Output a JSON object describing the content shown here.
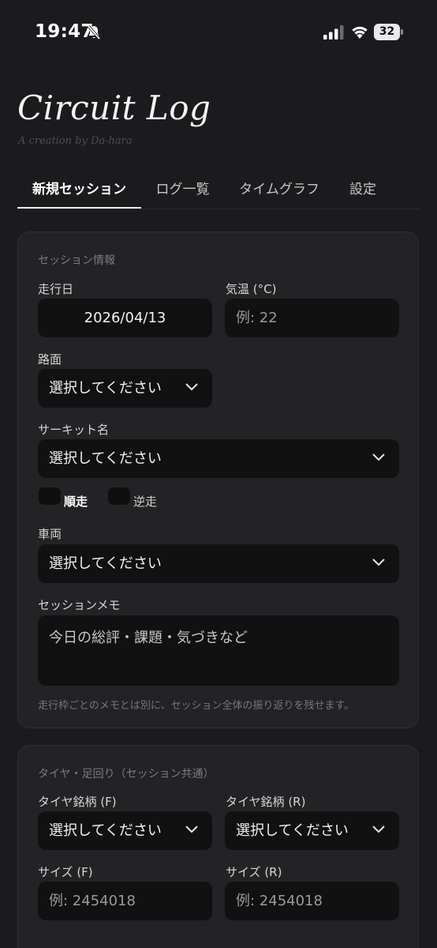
{
  "status": {
    "time": "19:47",
    "battery": "32"
  },
  "header": {
    "title": "Circuit Log",
    "subtitle": "A creation by Da-hara"
  },
  "tabs": [
    {
      "label": "新規セッション",
      "active": true
    },
    {
      "label": "ログ一覧"
    },
    {
      "label": "タイムグラフ"
    },
    {
      "label": "設定"
    }
  ],
  "session": {
    "section_title": "セッション情報",
    "date_label": "走行日",
    "date_value": "2026/04/13",
    "temp_label": "気温 (°C)",
    "temp_placeholder": "例: 22",
    "surface_label": "路面",
    "surface_value": "選択してください",
    "circuit_label": "サーキット名",
    "circuit_value": "選択してください",
    "direction_forward": "順走",
    "direction_reverse": "逆走",
    "vehicle_label": "車両",
    "vehicle_value": "選択してください",
    "memo_label": "セッションメモ",
    "memo_placeholder": "今日の総評・課題・気づきなど",
    "memo_hint": "走行枠ごとのメモとは別に、セッション全体の振り返りを残せます。"
  },
  "tires": {
    "section_title": "タイヤ・足回り（セッション共通）",
    "front_brand_label": "タイヤ銘柄 (F)",
    "front_brand_value": "選択してください",
    "rear_brand_label": "タイヤ銘柄 (R)",
    "rear_brand_value": "選択してください",
    "front_size_label": "サイズ (F)",
    "front_size_placeholder": "例: 2454018",
    "rear_size_label": "サイズ (R)",
    "rear_size_placeholder": "例: 2454018"
  }
}
